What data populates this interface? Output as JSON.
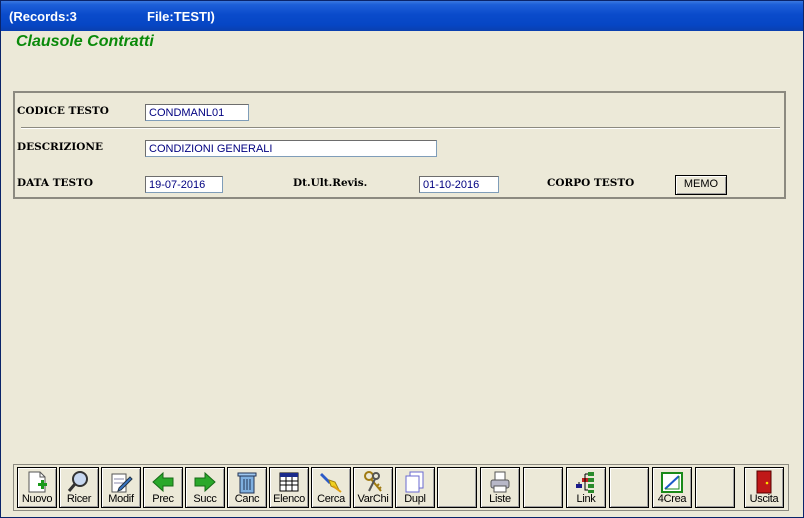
{
  "window": {
    "records_label": "(Records:3",
    "file_label": "File:TESTI)"
  },
  "form": {
    "title": "Clausole Contratti",
    "codice_label": "CODICE TESTO",
    "codice_value": "CONDMANL01",
    "descrizione_label": "DESCRIZIONE",
    "descrizione_value": "CONDIZIONI GENERALI",
    "data_label": "DATA TESTO",
    "data_value": "19-07-2016",
    "revis_label": "Dt.Ult.Revis.",
    "revis_value": "01-10-2016",
    "corpo_label": "CORPO TESTO",
    "memo_button": "MEMO"
  },
  "toolbar": {
    "buttons": [
      {
        "label": "Nuovo",
        "icon": "new-document-icon"
      },
      {
        "label": "Ricer",
        "icon": "magnifier-icon"
      },
      {
        "label": "Modif",
        "icon": "edit-document-icon"
      },
      {
        "label": "Prec",
        "icon": "arrow-left-icon"
      },
      {
        "label": "Succ",
        "icon": "arrow-right-icon"
      },
      {
        "label": "Canc",
        "icon": "trash-icon"
      },
      {
        "label": "Elenco",
        "icon": "table-icon"
      },
      {
        "label": "Cerca",
        "icon": "flashlight-icon"
      },
      {
        "label": "VarChi",
        "icon": "keys-icon"
      },
      {
        "label": "Dupl",
        "icon": "duplicate-icon"
      },
      {
        "label": "",
        "icon": ""
      },
      {
        "label": "Liste",
        "icon": "printer-icon"
      },
      {
        "label": "",
        "icon": ""
      },
      {
        "label": "Link",
        "icon": "tree-icon"
      },
      {
        "label": "",
        "icon": ""
      },
      {
        "label": "4Crea",
        "icon": "design-icon"
      },
      {
        "label": "",
        "icon": ""
      },
      {
        "label": "Uscita",
        "icon": "exit-door-icon"
      }
    ]
  },
  "colors": {
    "title_green": "#0a8a0a",
    "field_text": "#000080",
    "background": "#ece9d8",
    "titlebar": "#0a4bcb"
  }
}
